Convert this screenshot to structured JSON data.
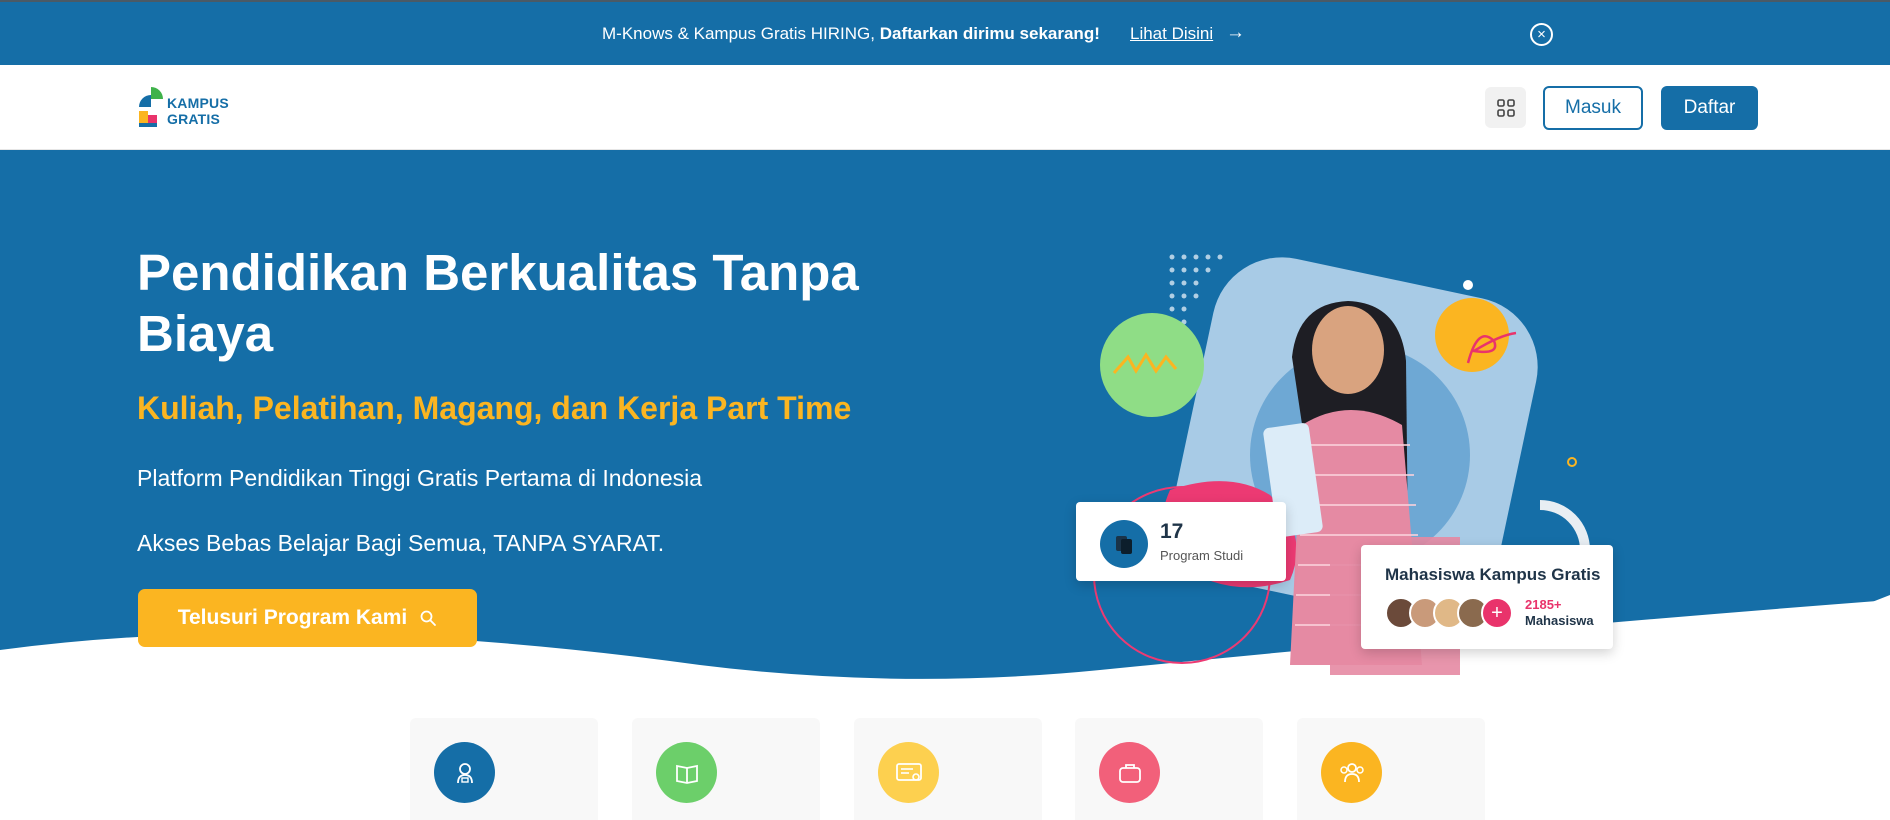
{
  "announcement": {
    "text": "M-Knows & Kampus Gratis HIRING, ",
    "highlight": "Daftarkan dirimu sekarang!",
    "link": "Lihat Disini",
    "arrow": "→",
    "close": "×"
  },
  "header": {
    "logo_line1": "KAMPUS",
    "logo_line2": "GRATIS",
    "login": "Masuk",
    "register": "Daftar"
  },
  "hero": {
    "title": "Pendidikan Berkualitas Tanpa Biaya",
    "subtitle": "Kuliah, Pelatihan, Magang, dan Kerja Part Time",
    "line1": "Platform Pendidikan Tinggi Gratis Pertama di Indonesia",
    "line2": "Akses Bebas Belajar Bagi Semua, TANPA SYARAT.",
    "cta": "Telusuri Program Kami"
  },
  "stats": {
    "program_count": "17",
    "program_label": "Program Studi",
    "students_title": "Mahasiswa Kampus Gratis",
    "students_count": "2185+",
    "students_label": "Mahasiswa"
  },
  "features": [
    {
      "icon": "graduate-icon",
      "color": "#156ea7"
    },
    {
      "icon": "book-icon",
      "color": "#6ccf6a"
    },
    {
      "icon": "certificate-icon",
      "color": "#fdd04f"
    },
    {
      "icon": "briefcase-icon",
      "color": "#f2607a"
    },
    {
      "icon": "users-icon",
      "color": "#fbb521"
    }
  ],
  "colors": {
    "brand_blue": "#156ea7",
    "accent_yellow": "#fbb521",
    "accent_pink": "#e9336b"
  }
}
